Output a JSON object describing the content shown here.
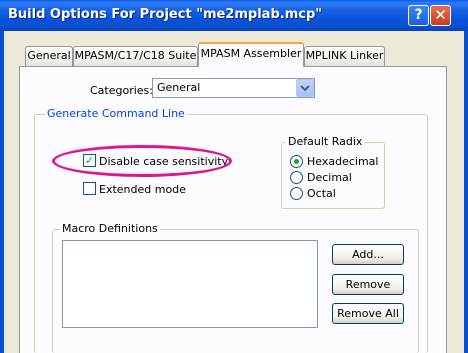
{
  "window": {
    "title": "Build Options For Project \"me2mplab.mcp\"",
    "help_glyph": "?",
    "close_glyph": "✕"
  },
  "tabs": [
    {
      "label": "General"
    },
    {
      "label": "MPASM/C17/C18 Suite"
    },
    {
      "label": "MPASM Assembler"
    },
    {
      "label": "MPLINK Linker"
    }
  ],
  "categories": {
    "label": "Categories:",
    "value": "General"
  },
  "generate_group": {
    "title": "Generate Command Line",
    "disable_case": {
      "label": "Disable case sensitivity",
      "checked": true
    },
    "extended_mode": {
      "label": "Extended mode",
      "checked": false
    }
  },
  "radix_group": {
    "title": "Default Radix",
    "options": [
      {
        "label": "Hexadecimal",
        "selected": true
      },
      {
        "label": "Decimal",
        "selected": false
      },
      {
        "label": "Octal",
        "selected": false
      }
    ]
  },
  "macro_group": {
    "title": "Macro Definitions",
    "add_label": "Add...",
    "remove_label": "Remove",
    "remove_all_label": "Remove All"
  },
  "colors": {
    "titlebar": "#0a5ee8",
    "highlight": "#e0168f",
    "active_tab_accent": "#f3a63b",
    "group_label": "#0046d5"
  }
}
